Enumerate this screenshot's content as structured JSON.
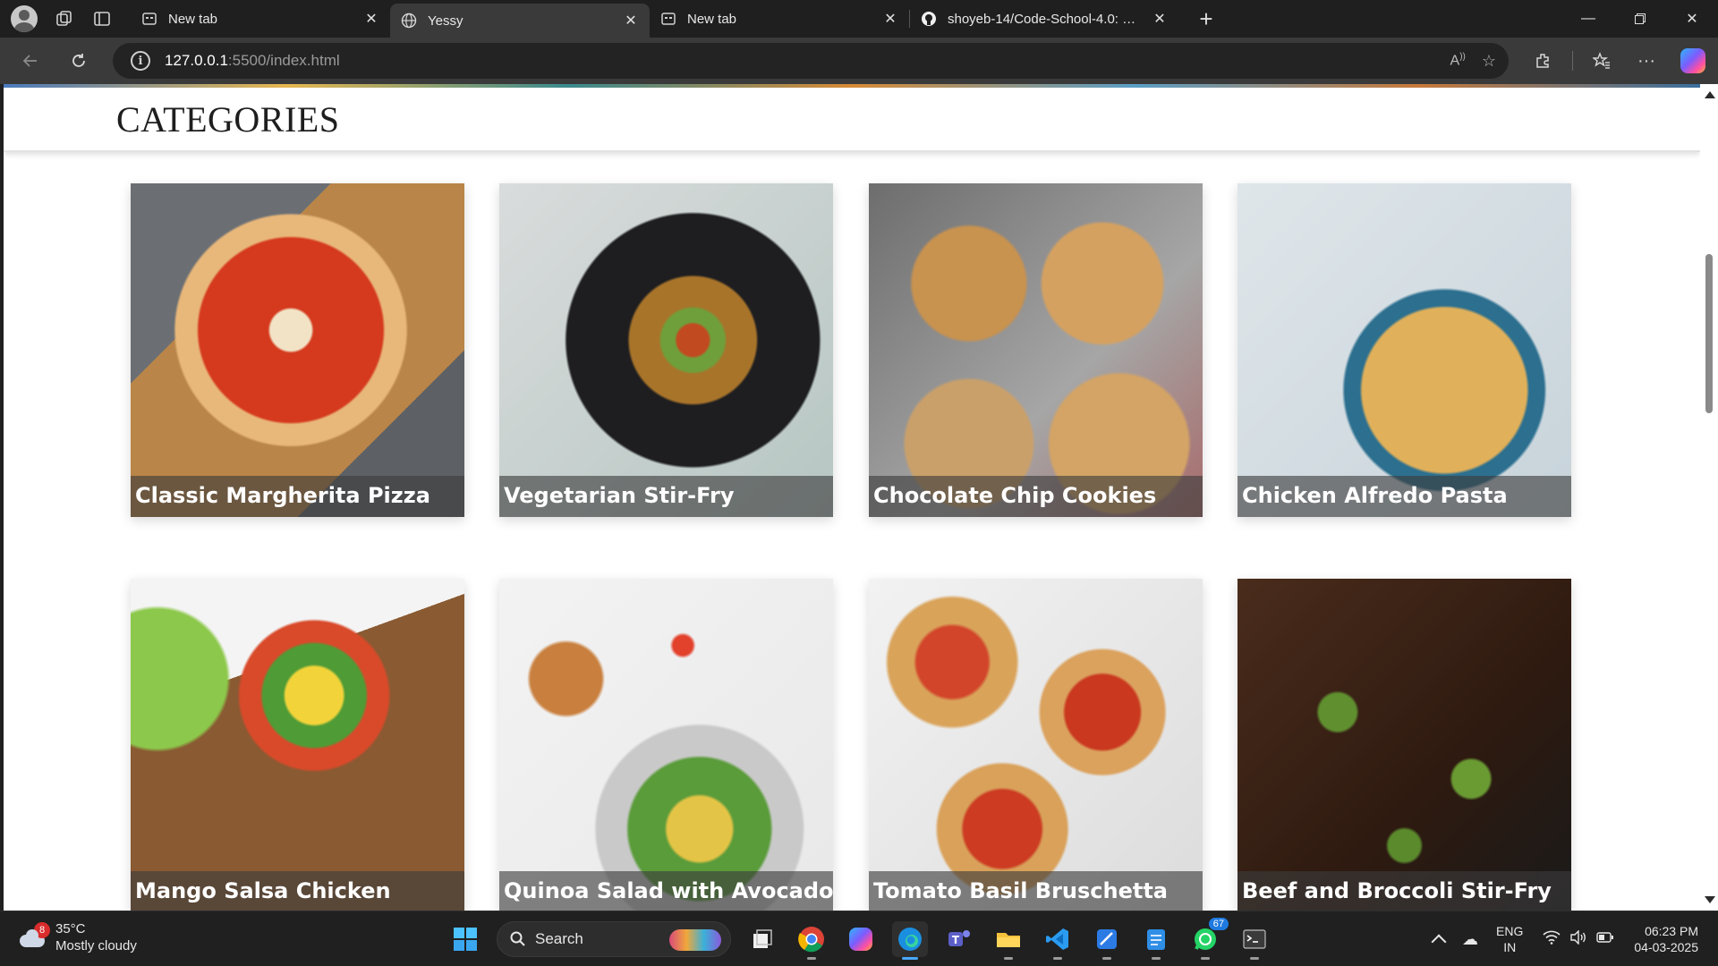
{
  "browser": {
    "tabs": [
      {
        "title": "New tab",
        "favicon": "newtab-icon",
        "active": false
      },
      {
        "title": "Yessy",
        "favicon": "globe-icon",
        "active": true
      },
      {
        "title": "New tab",
        "favicon": "newtab-icon",
        "active": false
      },
      {
        "title": "shoyeb-14/Code-School-4.0: Cod",
        "favicon": "github-icon",
        "active": false
      }
    ],
    "url_host": "127.0.0.1",
    "url_path": ":5500/index.html"
  },
  "page": {
    "heading": "CATEGORIES",
    "cards": [
      {
        "title": "Classic Margherita Pizza",
        "image": "pizza"
      },
      {
        "title": "Vegetarian Stir-Fry",
        "image": "stirfry"
      },
      {
        "title": "Chocolate Chip Cookies",
        "image": "cookies"
      },
      {
        "title": "Chicken Alfredo Pasta",
        "image": "pasta"
      },
      {
        "title": "Mango Salsa Chicken",
        "image": "mango"
      },
      {
        "title": "Quinoa Salad with Avocado",
        "image": "quinoa"
      },
      {
        "title": "Tomato Basil Bruschetta",
        "image": "bruschetta"
      },
      {
        "title": "Beef and Broccoli Stir-Fry",
        "image": "beef"
      }
    ]
  },
  "taskbar": {
    "weather": {
      "badge": "8",
      "temp": "35°C",
      "condition": "Mostly cloudy"
    },
    "search_label": "Search",
    "whatsapp_badge": "67",
    "language": {
      "line1": "ENG",
      "line2": "IN"
    },
    "clock": {
      "time": "06:23 PM",
      "date": "04-03-2025"
    }
  },
  "colors": {
    "accent": "#4aa8ff",
    "caption_bg": "#3c3c3c",
    "browser_dark": "#1f1f1f"
  }
}
